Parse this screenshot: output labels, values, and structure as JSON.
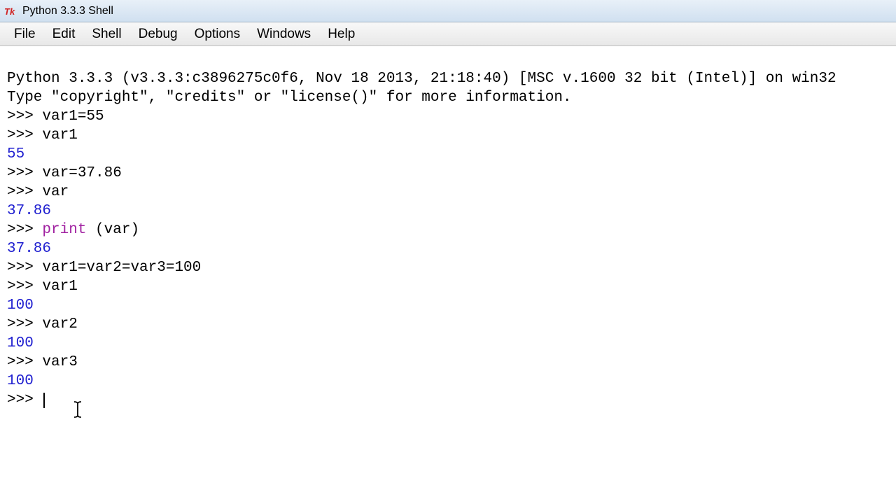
{
  "window": {
    "title": "Python 3.3.3 Shell"
  },
  "menu": {
    "file": "File",
    "edit": "Edit",
    "shell": "Shell",
    "debug": "Debug",
    "options": "Options",
    "windows": "Windows",
    "help": "Help"
  },
  "shell": {
    "banner1": "Python 3.3.3 (v3.3.3:c3896275c0f6, Nov 18 2013, 21:18:40) [MSC v.1600 32 bit (Intel)] on win32",
    "banner2": "Type \"copyright\", \"credits\" or \"license()\" for more information.",
    "prompt": ">>> ",
    "lines": {
      "l1_in": "var1=55",
      "l2_in": "var1",
      "l2_out": "55",
      "l3_in": "var=37.86",
      "l4_in": "var",
      "l4_out": "37.86",
      "l5_kw": "print",
      "l5_rest": " (var)",
      "l5_out": "37.86",
      "l6_in": "var1=var2=var3=100",
      "l7_in": "var1",
      "l7_out": "100",
      "l8_in": "var2",
      "l8_out": "100",
      "l9_in": "var3",
      "l9_out": "100"
    }
  }
}
